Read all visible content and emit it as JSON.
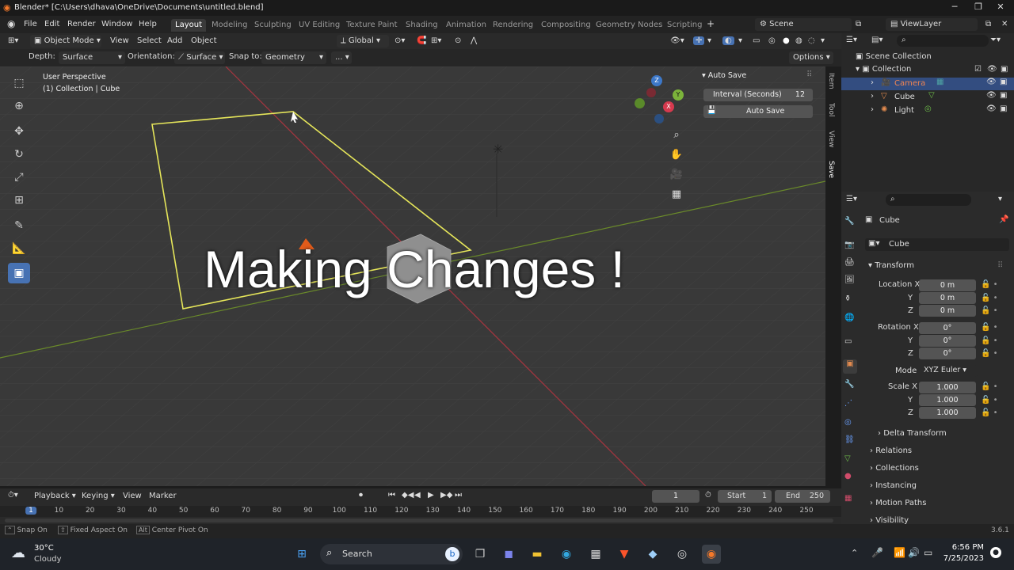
{
  "window": {
    "title": "Blender* [C:\\Users\\dhava\\OneDrive\\Documents\\untitled.blend]",
    "minimize": "─",
    "maximize": "❐",
    "close": "✕"
  },
  "menu": {
    "items": [
      "File",
      "Edit",
      "Render",
      "Window",
      "Help"
    ],
    "workspaces": [
      "Layout",
      "Modeling",
      "Sculpting",
      "UV Editing",
      "Texture Paint",
      "Shading",
      "Animation",
      "Rendering",
      "Compositing",
      "Geometry Nodes",
      "Scripting"
    ],
    "active_workspace": "Layout",
    "add": "+",
    "scene": "Scene",
    "view_layer": "ViewLayer"
  },
  "header": {
    "mode": "Object Mode",
    "view": "View",
    "select": "Select",
    "add": "Add",
    "object": "Object",
    "transform_orientation": "Global"
  },
  "tool_settings": {
    "depth_label": "Depth:",
    "depth_value": "Surface",
    "orientation_label": "Orientation:",
    "orientation_value": "Surface",
    "snap_label": "Snap to:",
    "snap_value": "Geometry",
    "more": "...",
    "options": "Options"
  },
  "viewport": {
    "perspective": "User Perspective",
    "collection": "(1) Collection | Cube",
    "overlay_text": "Making Changes !",
    "gizmo": {
      "z": "Z",
      "y": "Y",
      "x": "X"
    }
  },
  "autosave": {
    "title": "Auto Save",
    "interval_label": "Interval (Seconds)",
    "interval_value": "12",
    "button": "Auto Save"
  },
  "side_tabs": [
    "Item",
    "Tool",
    "View",
    "Save"
  ],
  "outliner": {
    "root": "Scene Collection",
    "collection": "Collection",
    "items": [
      "Camera",
      "Cube",
      "Light"
    ]
  },
  "properties": {
    "object_name": "Cube",
    "data_name": "Cube",
    "transform": "Transform",
    "location": {
      "label": "Location X",
      "x": "0 m",
      "y": "0 m",
      "z": "0 m"
    },
    "rotation": {
      "label": "Rotation X",
      "x": "0°",
      "y": "0°",
      "z": "0°"
    },
    "mode_label": "Mode",
    "mode_value": "XYZ Euler",
    "scale": {
      "label": "Scale X",
      "x": "1.000",
      "y": "1.000",
      "z": "1.000"
    },
    "axis_y": "Y",
    "axis_z": "Z",
    "sections": [
      "Delta Transform",
      "Relations",
      "Collections",
      "Instancing",
      "Motion Paths",
      "Visibility"
    ]
  },
  "timeline": {
    "playback": "Playback",
    "keying": "Keying",
    "view": "View",
    "marker": "Marker",
    "current_frame": "1",
    "start_label": "Start",
    "start": "1",
    "end_label": "End",
    "end": "250",
    "ruler": [
      "1",
      "10",
      "20",
      "30",
      "40",
      "50",
      "60",
      "70",
      "80",
      "90",
      "100",
      "110",
      "120",
      "130",
      "140",
      "150",
      "160",
      "170",
      "180",
      "190",
      "200",
      "210",
      "220",
      "230",
      "240",
      "250"
    ]
  },
  "status": {
    "snap": "Snap On",
    "fixed_aspect": "Fixed Aspect On",
    "center_pivot": "Center Pivot On",
    "version": "3.6.1"
  },
  "taskbar": {
    "temp": "30°C",
    "weather": "Cloudy",
    "search": "Search",
    "time": "6:56 PM",
    "date": "7/25/2023"
  }
}
